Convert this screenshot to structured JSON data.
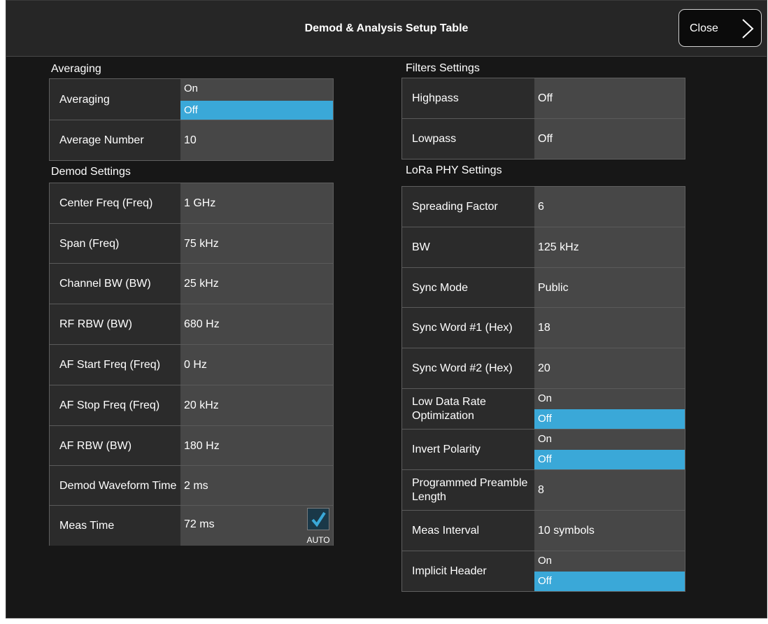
{
  "header": {
    "title": "Demod & Analysis Setup Table",
    "close_label": "Close"
  },
  "averaging": {
    "title": "Averaging",
    "rows": [
      {
        "label": "Averaging",
        "on": "On",
        "off": "Off",
        "selected": "Off"
      },
      {
        "label": "Average Number",
        "value": "10"
      }
    ]
  },
  "demod": {
    "title": "Demod Settings",
    "rows": [
      {
        "label": "Center Freq (Freq)",
        "value": "1 GHz"
      },
      {
        "label": "Span (Freq)",
        "value": "75 kHz"
      },
      {
        "label": "Channel BW (BW)",
        "value": "25 kHz"
      },
      {
        "label": "RF RBW (BW)",
        "value": "680 Hz"
      },
      {
        "label": "AF Start Freq (Freq)",
        "value": "0 Hz"
      },
      {
        "label": "AF Stop Freq (Freq)",
        "value": "20 kHz"
      },
      {
        "label": "AF RBW (BW)",
        "value": "180 Hz"
      },
      {
        "label": "Demod Waveform Time",
        "value": "2 ms"
      },
      {
        "label": "Meas Time",
        "value": "72 ms",
        "auto_label": "AUTO",
        "auto_checked": true
      }
    ]
  },
  "filters": {
    "title": "Filters Settings",
    "rows": [
      {
        "label": "Highpass",
        "value": "Off"
      },
      {
        "label": "Lowpass",
        "value": "Off"
      }
    ]
  },
  "lora": {
    "title": "LoRa PHY Settings",
    "rows": [
      {
        "label": "Spreading Factor",
        "value": "6"
      },
      {
        "label": "BW",
        "value": "125 kHz"
      },
      {
        "label": "Sync Mode",
        "value": "Public"
      },
      {
        "label": "Sync Word #1 (Hex)",
        "value": "18"
      },
      {
        "label": "Sync Word #2 (Hex)",
        "value": "20"
      },
      {
        "label": "Low Data Rate Optimization",
        "on": "On",
        "off": "Off",
        "selected": "Off"
      },
      {
        "label": "Invert Polarity",
        "on": "On",
        "off": "Off",
        "selected": "Off"
      },
      {
        "label": "Programmed Preamble Length",
        "value": "8"
      },
      {
        "label": "Meas Interval",
        "value": "10 symbols"
      },
      {
        "label": "Implicit Header",
        "on": "On",
        "off": "Off",
        "selected": "Off"
      }
    ]
  },
  "colors": {
    "selected": "#3aa8d8",
    "value_bg": "#474747",
    "label_bg": "#2b2b2b"
  },
  "icons": {
    "close": "chevron-right-icon",
    "auto": "checkmark-icon"
  }
}
